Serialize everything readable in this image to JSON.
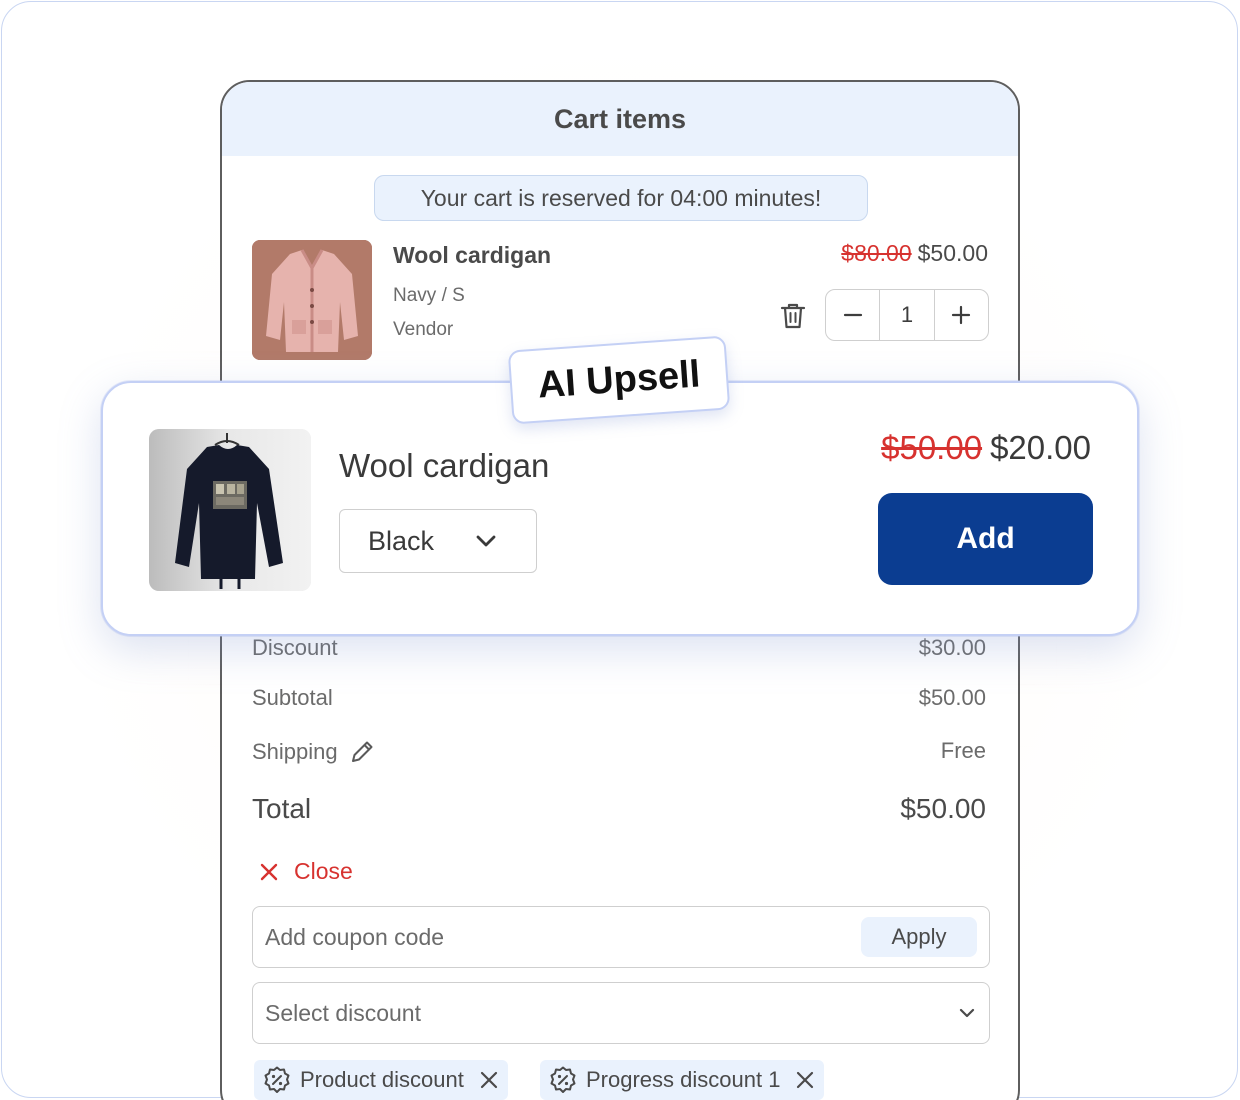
{
  "cart": {
    "title": "Cart items",
    "reserve_message": "Your cart is reserved for 04:00 minutes!",
    "item": {
      "title": "Wool cardigan",
      "variant": "Navy / S",
      "vendor": "Vendor",
      "price_original": "$80.00",
      "price_current": "$50.00",
      "quantity": "1",
      "thumbnail_icon": "cardigan-photo"
    },
    "summary": {
      "discount_label": "Discount",
      "discount_value": "$30.00",
      "subtotal_label": "Subtotal",
      "subtotal_value": "$50.00",
      "shipping_label": "Shipping",
      "shipping_value": "Free",
      "total_label": "Total",
      "total_value": "$50.00"
    },
    "close_label": "Close",
    "coupon": {
      "placeholder": "Add coupon code",
      "value": "",
      "apply_label": "Apply"
    },
    "discount_select": {
      "placeholder": "Select discount"
    },
    "tags": [
      {
        "label": "Product discount",
        "icon": "discount-badge-icon"
      },
      {
        "label": "Progress discount 1",
        "icon": "discount-badge-icon"
      }
    ]
  },
  "upsell": {
    "badge": "AI Upsell",
    "title": "Wool cardigan",
    "variant_selected": "Black",
    "price_original": "$50.00",
    "price_current": "$20.00",
    "add_label": "Add",
    "thumbnail_icon": "sweatshirt-photo"
  },
  "colors": {
    "accent_blue": "#0b3d91",
    "header_bg": "#eaf2fd",
    "strike_red": "#d7322f",
    "close_red": "#d7322f"
  }
}
